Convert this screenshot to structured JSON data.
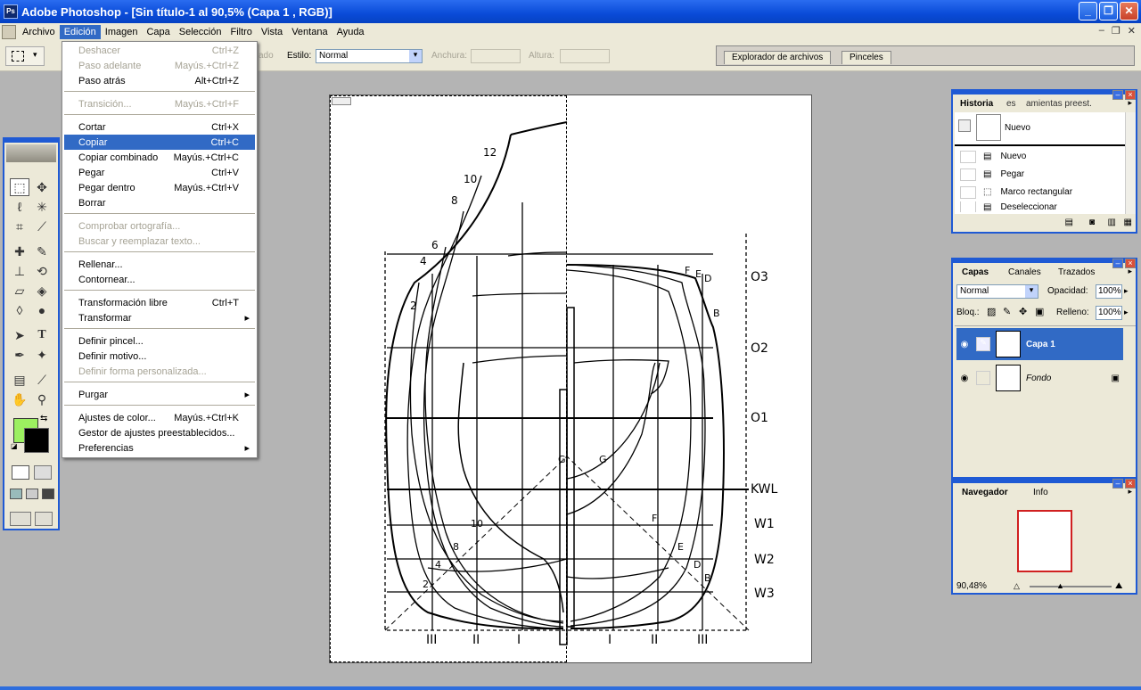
{
  "window": {
    "title": "Adobe Photoshop - [Sin título-1 al 90,5% (Capa 1 , RGB)]",
    "min": "_",
    "max": "❐",
    "close": "✕"
  },
  "menu": {
    "items": [
      "Archivo",
      "Edición",
      "Imagen",
      "Capa",
      "Selección",
      "Filtro",
      "Vista",
      "Ventana",
      "Ayuda"
    ],
    "active": "Edición",
    "doc_min": "–",
    "doc_restore": "❐",
    "doc_close": "✕"
  },
  "options": {
    "estilo_label": "Estilo:",
    "estilo_value": "Normal",
    "anchura_label": "Anchura:",
    "altura_label": "Altura:",
    "suavizado_label": "ado"
  },
  "palette_well": {
    "tabs": [
      "Explorador de archivos",
      "Pinceles"
    ]
  },
  "edit_menu": {
    "deshacer": "Deshacer",
    "deshacer_sc": "Ctrl+Z",
    "paso_adelante": "Paso adelante",
    "paso_adelante_sc": "Mayús.+Ctrl+Z",
    "paso_atras": "Paso atrás",
    "paso_atras_sc": "Alt+Ctrl+Z",
    "transicion": "Transición...",
    "transicion_sc": "Mayús.+Ctrl+F",
    "cortar": "Cortar",
    "cortar_sc": "Ctrl+X",
    "copiar": "Copiar",
    "copiar_sc": "Ctrl+C",
    "copiar_combinado": "Copiar combinado",
    "copiar_combinado_sc": "Mayús.+Ctrl+C",
    "pegar": "Pegar",
    "pegar_sc": "Ctrl+V",
    "pegar_dentro": "Pegar dentro",
    "pegar_dentro_sc": "Mayús.+Ctrl+V",
    "borrar": "Borrar",
    "comprobar": "Comprobar ortografía...",
    "buscar": "Buscar y reemplazar texto...",
    "rellenar": "Rellenar...",
    "contornear": "Contornear...",
    "transformacion_libre": "Transformación libre",
    "transformacion_libre_sc": "Ctrl+T",
    "transformar": "Transformar",
    "definir_pincel": "Definir pincel...",
    "definir_motivo": "Definir motivo...",
    "definir_forma": "Definir forma personalizada...",
    "purgar": "Purgar",
    "ajustes_color": "Ajustes de color...",
    "ajustes_color_sc": "Mayús.+Ctrl+K",
    "gestor": "Gestor de ajustes preestablecidos...",
    "preferencias": "Preferencias"
  },
  "canvas": {
    "labels": [
      "O3",
      "O2",
      "O1",
      "KWL",
      "W1",
      "W2",
      "W3",
      "III",
      "II",
      "I",
      "I",
      "II",
      "III",
      "12",
      "10",
      "8",
      "6",
      "4",
      "2",
      "F",
      "E",
      "D",
      "B",
      "G",
      "F",
      "E",
      "D",
      "B",
      "G",
      "10",
      "8",
      "4",
      "2"
    ]
  },
  "history": {
    "tabs": [
      "Historia",
      "es",
      "amientas preest."
    ],
    "snapshot": "Nuevo",
    "items": [
      "Nuevo",
      "Pegar",
      "Marco rectangular",
      "Deseleccionar"
    ]
  },
  "layers": {
    "tabs": [
      "Capas",
      "Canales",
      "Trazados"
    ],
    "blend": "Normal",
    "opacity_label": "Opacidad:",
    "opacity": "100%",
    "lock_label": "Bloq.:",
    "fill_label": "Relleno:",
    "fill": "100%",
    "items": [
      {
        "name": "Capa 1"
      },
      {
        "name": "Fondo"
      }
    ]
  },
  "navigator": {
    "tabs": [
      "Navegador",
      "Info"
    ],
    "zoom": "90,48%"
  },
  "colors": {
    "fg": "#9cf060",
    "bg": "#000000",
    "accent": "#316ac5"
  }
}
